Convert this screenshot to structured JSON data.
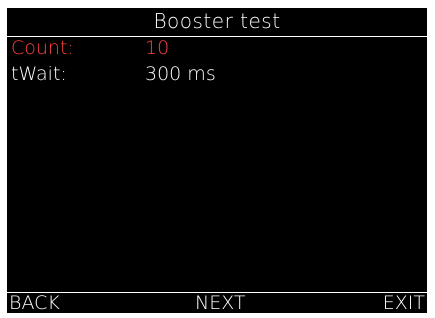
{
  "title": "Booster test",
  "params": [
    {
      "label": "Count:",
      "value": "10",
      "selected": true
    },
    {
      "label": "tWait:",
      "value": "300 ms",
      "selected": false
    }
  ],
  "footer": {
    "back_label": "BACK",
    "next_label": "NEXT",
    "exit_label": "EXIT"
  },
  "colors": {
    "background": "#000000",
    "text": "#ffffff",
    "selected": "#ff4040"
  }
}
